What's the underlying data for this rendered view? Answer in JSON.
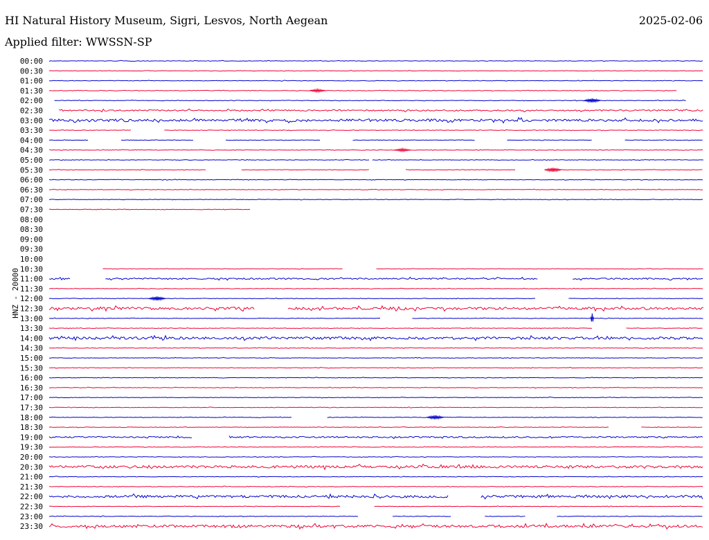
{
  "header": {
    "station_title": "HI Natural History Museum, Sigri, Lesvos, North Aegean",
    "date": "2025-02-06",
    "filter_label": "Applied filter: WWSSN-SP",
    "channel_label": "HNZ - 20000"
  },
  "colors": {
    "even_row": "#0000cc",
    "odd_row": "#ee0033",
    "text": "#000000"
  },
  "chart_data": {
    "type": "line",
    "title": "HI Natural History Museum, Sigri, Lesvos, North Aegean",
    "ylabel": "HNZ - 20000",
    "xlabel": "",
    "minutes_per_row": 30,
    "rows": [
      {
        "time": "00:00",
        "segments": [
          [
            0,
            1
          ]
        ],
        "activity": "low"
      },
      {
        "time": "00:30",
        "segments": [
          [
            0,
            1
          ]
        ],
        "activity": "low"
      },
      {
        "time": "01:00",
        "segments": [
          [
            0,
            1
          ]
        ],
        "activity": "low"
      },
      {
        "time": "01:30",
        "segments": [
          [
            0,
            0.96
          ]
        ],
        "activity": "low"
      },
      {
        "time": "02:00",
        "segments": [
          [
            0.008,
            0.975
          ]
        ],
        "activity": "low"
      },
      {
        "time": "02:30",
        "segments": [
          [
            0.015,
            1
          ]
        ],
        "activity": "medium"
      },
      {
        "time": "03:00",
        "segments": [
          [
            0,
            1
          ]
        ],
        "activity": "high"
      },
      {
        "time": "03:30",
        "segments": [
          [
            0,
            0.126
          ],
          [
            0.176,
            1
          ]
        ],
        "activity": "low"
      },
      {
        "time": "04:00",
        "segments": [
          [
            0,
            0.06
          ],
          [
            0.11,
            0.222
          ],
          [
            0.27,
            0.415
          ],
          [
            0.464,
            0.652
          ],
          [
            0.7,
            0.83
          ],
          [
            0.88,
            1
          ]
        ],
        "activity": "low"
      },
      {
        "time": "04:30",
        "segments": [
          [
            0,
            1
          ]
        ],
        "activity": "low"
      },
      {
        "time": "05:00",
        "segments": [
          [
            0,
            0.49
          ],
          [
            0.494,
            1
          ]
        ],
        "activity": "low"
      },
      {
        "time": "05:30",
        "segments": [
          [
            0,
            0.24
          ],
          [
            0.294,
            0.49
          ],
          [
            0.545,
            0.713
          ],
          [
            0.757,
            1
          ]
        ],
        "activity": "low"
      },
      {
        "time": "06:00",
        "segments": [
          [
            0,
            1
          ]
        ],
        "activity": "low"
      },
      {
        "time": "06:30",
        "segments": [
          [
            0,
            1
          ]
        ],
        "activity": "low"
      },
      {
        "time": "07:00",
        "segments": [
          [
            0,
            1
          ]
        ],
        "activity": "low"
      },
      {
        "time": "07:30",
        "segments": [
          [
            0,
            0.307
          ]
        ],
        "activity": "low"
      },
      {
        "time": "08:00",
        "segments": [],
        "activity": "none"
      },
      {
        "time": "08:30",
        "segments": [],
        "activity": "none"
      },
      {
        "time": "09:00",
        "segments": [],
        "activity": "none"
      },
      {
        "time": "09:30",
        "segments": [],
        "activity": "none"
      },
      {
        "time": "10:00",
        "segments": [],
        "activity": "none"
      },
      {
        "time": "10:30",
        "segments": [
          [
            0.082,
            0.45
          ],
          [
            0.5,
            1
          ]
        ],
        "activity": "low"
      },
      {
        "time": "11:00",
        "segments": [
          [
            0,
            0.033
          ],
          [
            0.086,
            0.747
          ],
          [
            0.8,
            1
          ]
        ],
        "activity": "medium"
      },
      {
        "time": "11:30",
        "segments": [
          [
            0,
            1
          ]
        ],
        "activity": "low"
      },
      {
        "time": "12:00",
        "segments": [
          [
            0,
            0.744
          ],
          [
            0.794,
            1
          ]
        ],
        "activity": "low"
      },
      {
        "time": "12:30",
        "segments": [
          [
            0,
            0.314
          ],
          [
            0.365,
            1
          ]
        ],
        "activity": "high"
      },
      {
        "time": "13:00",
        "segments": [
          [
            0,
            0.506
          ],
          [
            0.555,
            1
          ]
        ],
        "activity": "low"
      },
      {
        "time": "13:30",
        "segments": [
          [
            0,
            0.83
          ],
          [
            0.882,
            1
          ]
        ],
        "activity": "low"
      },
      {
        "time": "14:00",
        "segments": [
          [
            0,
            1
          ]
        ],
        "activity": "high"
      },
      {
        "time": "14:30",
        "segments": [
          [
            0,
            1
          ]
        ],
        "activity": "low"
      },
      {
        "time": "15:00",
        "segments": [
          [
            0,
            1
          ]
        ],
        "activity": "low"
      },
      {
        "time": "15:30",
        "segments": [
          [
            0,
            1
          ]
        ],
        "activity": "low"
      },
      {
        "time": "16:00",
        "segments": [
          [
            0,
            1
          ]
        ],
        "activity": "low"
      },
      {
        "time": "16:30",
        "segments": [
          [
            0,
            1
          ]
        ],
        "activity": "low"
      },
      {
        "time": "17:00",
        "segments": [
          [
            0,
            1
          ]
        ],
        "activity": "low"
      },
      {
        "time": "17:30",
        "segments": [
          [
            0,
            1
          ]
        ],
        "activity": "low"
      },
      {
        "time": "18:00",
        "segments": [
          [
            0,
            0.372
          ],
          [
            0.425,
            1
          ]
        ],
        "activity": "low"
      },
      {
        "time": "18:30",
        "segments": [
          [
            0,
            0.856
          ],
          [
            0.905,
            1
          ]
        ],
        "activity": "low"
      },
      {
        "time": "19:00",
        "segments": [
          [
            0,
            0.22
          ],
          [
            0.275,
            1
          ]
        ],
        "activity": "medium"
      },
      {
        "time": "19:30",
        "segments": [
          [
            0,
            1
          ]
        ],
        "activity": "low"
      },
      {
        "time": "20:00",
        "segments": [
          [
            0,
            1
          ]
        ],
        "activity": "low"
      },
      {
        "time": "20:30",
        "segments": [
          [
            0,
            1
          ]
        ],
        "activity": "high"
      },
      {
        "time": "21:00",
        "segments": [
          [
            0,
            1
          ]
        ],
        "activity": "low"
      },
      {
        "time": "21:30",
        "segments": [
          [
            0,
            1
          ]
        ],
        "activity": "low"
      },
      {
        "time": "22:00",
        "segments": [
          [
            0,
            0.61
          ],
          [
            0.66,
            1
          ]
        ],
        "activity": "high"
      },
      {
        "time": "22:30",
        "segments": [
          [
            0,
            0.445
          ],
          [
            0.497,
            1
          ]
        ],
        "activity": "low"
      },
      {
        "time": "23:00",
        "segments": [
          [
            0,
            0.474
          ],
          [
            0.525,
            0.616
          ],
          [
            0.666,
            0.728
          ],
          [
            0.776,
            1
          ]
        ],
        "activity": "low"
      },
      {
        "time": "23:30",
        "segments": [
          [
            0,
            1
          ]
        ],
        "activity": "high"
      }
    ],
    "events": [
      {
        "time": "13:00",
        "position": 0.83,
        "amplitude": "large"
      },
      {
        "time": "02:00",
        "position": 0.83,
        "amplitude": "medium"
      },
      {
        "time": "18:00",
        "position": 0.59,
        "amplitude": "medium"
      },
      {
        "time": "12:00",
        "position": 0.165,
        "amplitude": "medium"
      },
      {
        "time": "05:30",
        "position": 0.77,
        "amplitude": "medium"
      },
      {
        "time": "01:30",
        "position": 0.41,
        "amplitude": "small"
      },
      {
        "time": "04:30",
        "position": 0.54,
        "amplitude": "small"
      }
    ],
    "grid": false,
    "legend": "none"
  }
}
